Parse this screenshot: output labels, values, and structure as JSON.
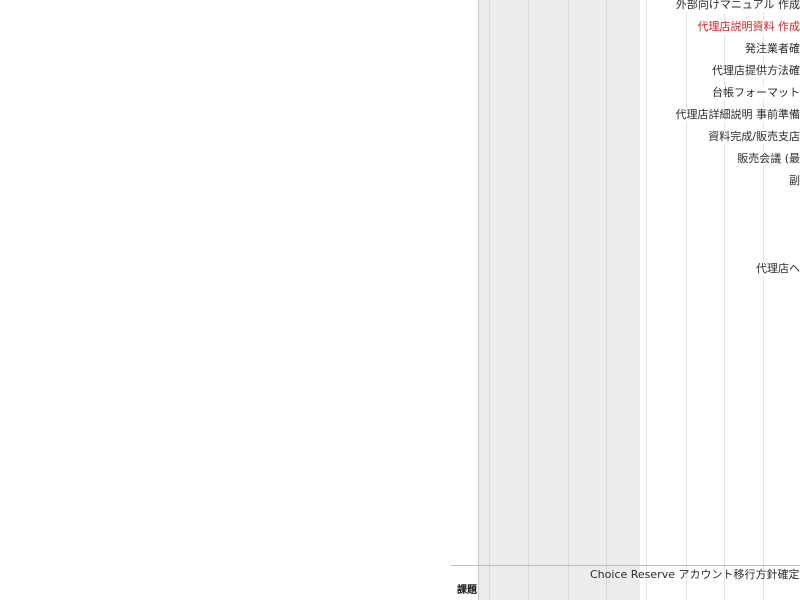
{
  "colors": {
    "highlight_task": "#c62828",
    "default_text": "#2a2a2a",
    "weekend_shading": "#ececec",
    "grid_line": "#dadada"
  },
  "tasks": [
    {
      "label": "外部向けマニュアル 作成",
      "highlight": false
    },
    {
      "label": "代理店説明資料 作成",
      "highlight": true
    },
    {
      "label": "発注業者確",
      "highlight": false
    },
    {
      "label": "代理店提供方法確",
      "highlight": false
    },
    {
      "label": "台帳フォーマット",
      "highlight": false
    },
    {
      "label": "代理店詳細説明 事前準備",
      "highlight": false
    },
    {
      "label": "資料完成/販売支店",
      "highlight": false
    },
    {
      "label": "販売会議 (最",
      "highlight": false
    },
    {
      "label": "副",
      "highlight": false
    },
    {
      "label": "代理店ヘ",
      "highlight": false
    }
  ],
  "group": {
    "label": "課題"
  },
  "milestone": {
    "label": "Choice Reserve アカウント移行方針確定"
  }
}
